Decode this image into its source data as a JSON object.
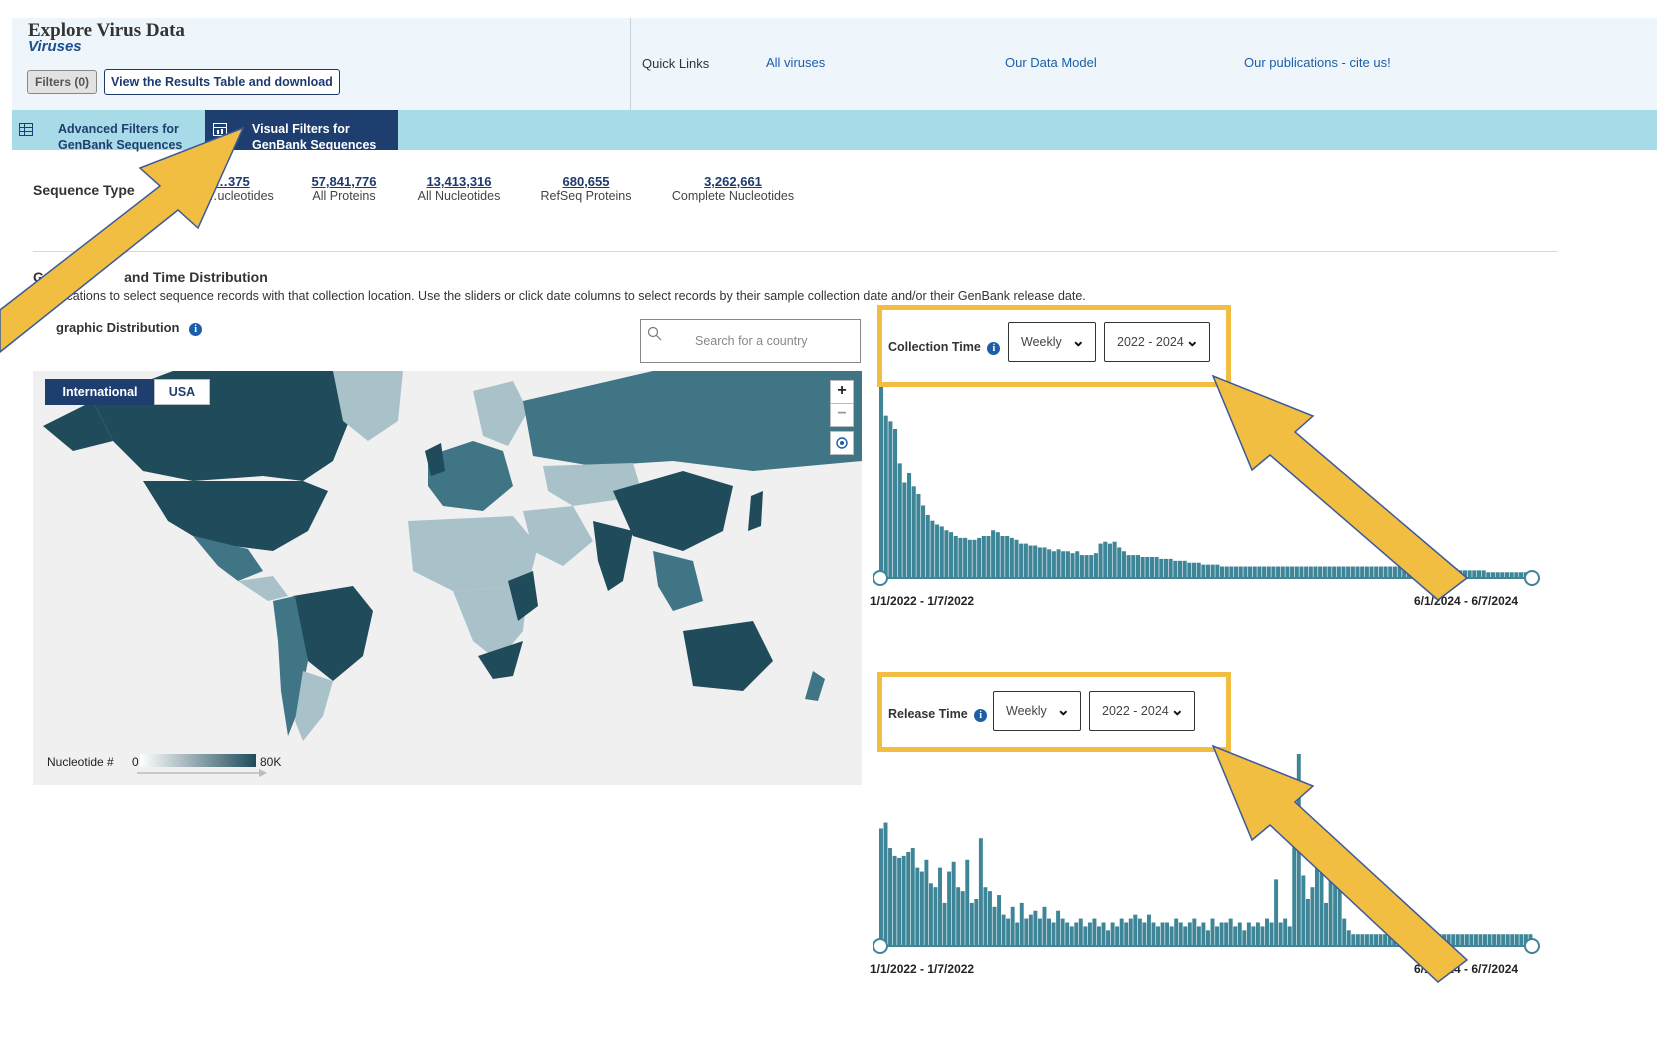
{
  "header": {
    "title": "Explore Virus Data",
    "subtitle": "Viruses",
    "filters_button": "Filters (0)",
    "results_button": "View the Results Table and download",
    "quick_links_label": "Quick Links",
    "quick_links": [
      "All viruses",
      "Our Data Model",
      "Our publications - cite us!"
    ]
  },
  "tabs": [
    {
      "label_line1": "Advanced Filters for",
      "label_line2": "GenBank Sequences",
      "icon": "table-icon"
    },
    {
      "label_line1": "Visual Filters for",
      "label_line2": "GenBank Sequences",
      "icon": "chart-icon"
    }
  ],
  "sequence_type": {
    "label": "Sequence Type",
    "items": [
      {
        "count": "…375",
        "caption": "…ucleotides"
      },
      {
        "count": "57,841,776",
        "caption": "All Proteins"
      },
      {
        "count": "13,413,316",
        "caption": "All Nucleotides"
      },
      {
        "count": "680,655",
        "caption": "RefSeq Proteins"
      },
      {
        "count": "3,262,661",
        "caption": "Complete Nucleotides"
      }
    ]
  },
  "geo": {
    "heading_start": "Geogr",
    "heading_end": "and Time Distribution",
    "desc_start": "Ch",
    "desc_end": "cations to select sequence records with that collection location. Use the sliders or click date columns to select records by their sample collection date and/or their GenBank release date.",
    "distribution_label": "graphic Distribution",
    "search_placeholder": "Search for a country",
    "map_tab_international": "International",
    "map_tab_usa": "USA",
    "zoom_in": "+",
    "zoom_out": "−",
    "legend_label": "Nucleotide #",
    "legend_min": "0",
    "legend_max": "80K",
    "colors": {
      "dark": "#1f4b5a",
      "mid": "#3f7585",
      "light": "#a9c2ca",
      "none": "#e6e6e6"
    }
  },
  "collection": {
    "label": "Collection Time",
    "interval": "Weekly",
    "range": "2022 - 2024",
    "start_label": "1/1/2022 - 1/7/2022",
    "end_label": "6/1/2024 - 6/7/2024"
  },
  "release": {
    "label": "Release Time",
    "interval": "Weekly",
    "range": "2022 - 2024",
    "start_label": "1/1/2022 - 1/7/2022",
    "end_label": "6/1/2024 - 6/7/2024"
  },
  "chart_data": [
    {
      "type": "bar",
      "title": "Collection Time",
      "bar_color": "#3d8597",
      "values": [
        100,
        85,
        82,
        78,
        60,
        50,
        55,
        48,
        44,
        38,
        33,
        30,
        28,
        27,
        25,
        24,
        22,
        21,
        21,
        20,
        20,
        21,
        22,
        22,
        25,
        24,
        22,
        22,
        21,
        20,
        18,
        18,
        17,
        17,
        16,
        16,
        15,
        14,
        15,
        14,
        14,
        13,
        14,
        12,
        12,
        12,
        13,
        18,
        19,
        18,
        19,
        16,
        14,
        12,
        12,
        12,
        11,
        11,
        11,
        11,
        10,
        10,
        10,
        9,
        9,
        9,
        8,
        8,
        8,
        7,
        7,
        7,
        7,
        6,
        6,
        6,
        6,
        6,
        6,
        6,
        6,
        6,
        6,
        6,
        6,
        6,
        6,
        6,
        6,
        6,
        6,
        6,
        6,
        6,
        6,
        6,
        6,
        6,
        6,
        6,
        6,
        6,
        6,
        6,
        6,
        6,
        6,
        6,
        6,
        6,
        6,
        6,
        6,
        6,
        6,
        6,
        6,
        6,
        6,
        6,
        6,
        5,
        5,
        5,
        4,
        4,
        4,
        4,
        4,
        4,
        3,
        3,
        3,
        3,
        3,
        3,
        3,
        3,
        3,
        3
      ],
      "xlabel": "",
      "ylabel": ""
    },
    {
      "type": "bar",
      "title": "Release Time",
      "bar_color": "#3d8597",
      "values": [
        60,
        63,
        50,
        46,
        45,
        46,
        48,
        50,
        40,
        38,
        44,
        32,
        30,
        40,
        22,
        38,
        43,
        30,
        28,
        44,
        22,
        24,
        55,
        30,
        28,
        20,
        26,
        16,
        14,
        20,
        12,
        22,
        14,
        16,
        18,
        14,
        20,
        14,
        12,
        18,
        14,
        12,
        10,
        12,
        14,
        10,
        12,
        14,
        10,
        12,
        8,
        12,
        10,
        14,
        12,
        14,
        16,
        14,
        12,
        16,
        12,
        10,
        12,
        12,
        10,
        14,
        12,
        10,
        12,
        14,
        10,
        12,
        8,
        14,
        10,
        12,
        12,
        14,
        10,
        12,
        8,
        12,
        10,
        12,
        10,
        14,
        12,
        34,
        12,
        14,
        10,
        60,
        98,
        36,
        24,
        30,
        40,
        38,
        22,
        48,
        52,
        36,
        14,
        8,
        6,
        6,
        6,
        6,
        6,
        6,
        6,
        6,
        6,
        6,
        6,
        6,
        6,
        6,
        6,
        6,
        6,
        6,
        6,
        6,
        6,
        6,
        6,
        6,
        6,
        6,
        6,
        6,
        6,
        6,
        6,
        6,
        6,
        6,
        6,
        6,
        6,
        6,
        6,
        6
      ],
      "xlabel": "",
      "ylabel": ""
    }
  ]
}
